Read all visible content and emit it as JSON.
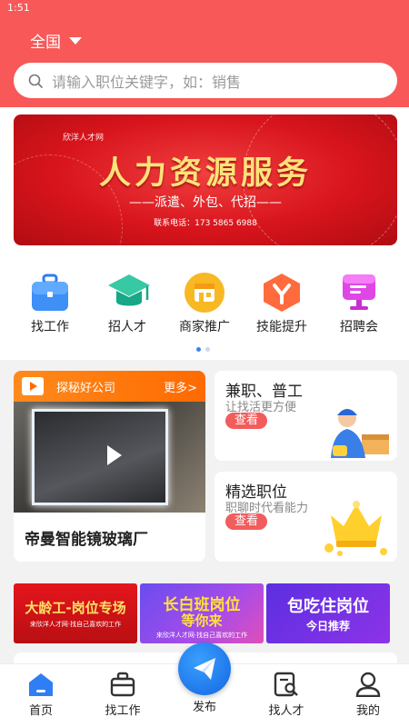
{
  "status_bar": {
    "time": "1:51"
  },
  "header": {
    "region": "全国",
    "search_placeholder": "请输入职位关键字，如：销售"
  },
  "banner": {
    "small_text": "欣洋人才网",
    "title": "人力资源服务",
    "subtitle": "——派遣、外包、代招——",
    "phone": "联系电话：173 5865 6988"
  },
  "categories": [
    {
      "label": "找工作",
      "icon": "briefcase-icon"
    },
    {
      "label": "招人才",
      "icon": "graduation-cap-icon"
    },
    {
      "label": "商家推广",
      "icon": "store-icon"
    },
    {
      "label": "技能提升",
      "icon": "skill-y-icon"
    },
    {
      "label": "招聘会",
      "icon": "monitor-icon"
    }
  ],
  "company_card": {
    "header": "探秘好公司",
    "more": "更多>",
    "company_name": "帝曼智能镜玻璃厂"
  },
  "part_time_card": {
    "title": "兼职、普工",
    "subtitle": "让找活更方便",
    "button": "查看"
  },
  "selected_card": {
    "title": "精选职位",
    "subtitle": "职聊时代看能力",
    "button": "查看"
  },
  "promos": [
    {
      "title": "大龄工-岗位专场",
      "sub": "来欣洋人才网·找自己喜欢的工作"
    },
    {
      "title": "长白班岗位",
      "title2": "等你来",
      "sub": "来欣洋人才网·找自己喜欢的工作"
    },
    {
      "title": "包吃住岗位",
      "title2": "今日推荐"
    }
  ],
  "nav": {
    "home": "首页",
    "jobs": "找工作",
    "publish": "发布",
    "talent": "找人才",
    "mine": "我的"
  },
  "colors": {
    "header": "#f85858",
    "accent_orange": "#ff6a00",
    "nav_active": "#2f7ef5"
  }
}
